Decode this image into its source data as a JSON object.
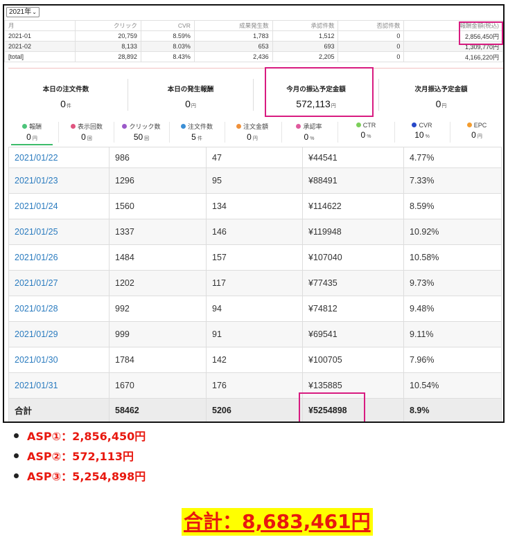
{
  "monthly": {
    "year_select": "2021年",
    "headers": [
      "月",
      "クリック",
      "CVR",
      "成果発生数",
      "承認件数",
      "否認件数",
      "報酬金額(税込)"
    ],
    "rows": [
      [
        "2021-01",
        "20,759",
        "8.59%",
        "1,783",
        "1,512",
        "0",
        "2,856,450円"
      ],
      [
        "2021-02",
        "8,133",
        "8.03%",
        "653",
        "693",
        "0",
        "1,309,770円"
      ],
      [
        "[total]",
        "28,892",
        "8.43%",
        "2,436",
        "2,205",
        "0",
        "4,166,220円"
      ]
    ]
  },
  "summary": [
    {
      "label": "本日の注文件数",
      "value": "0",
      "unit": "件"
    },
    {
      "label": "本日の発生報酬",
      "value": "0",
      "unit": "円"
    },
    {
      "label": "今月の振込予定金額",
      "value": "572,113",
      "unit": "円"
    },
    {
      "label": "次月振込予定金額",
      "value": "0",
      "unit": "円"
    }
  ],
  "metrics": [
    {
      "label": "報酬",
      "value": "0",
      "unit": "円",
      "color": "#4cc47a"
    },
    {
      "label": "表示回数",
      "value": "0",
      "unit": "回",
      "color": "#e0557f"
    },
    {
      "label": "クリック数",
      "value": "50",
      "unit": "回",
      "color": "#9b59c9"
    },
    {
      "label": "注文件数",
      "value": "5",
      "unit": "件",
      "color": "#3b8fd6"
    },
    {
      "label": "注文金額",
      "value": "0",
      "unit": "円",
      "color": "#f0913a"
    },
    {
      "label": "承認率",
      "value": "0",
      "unit": "%",
      "color": "#e05a9e"
    },
    {
      "label": "CTR",
      "value": "0",
      "unit": "%",
      "color": "#7ccf5a"
    },
    {
      "label": "CVR",
      "value": "10",
      "unit": "%",
      "color": "#2748c9"
    },
    {
      "label": "EPC",
      "value": "0",
      "unit": "円",
      "color": "#f39c2e"
    }
  ],
  "daily": {
    "rows": [
      [
        "2021/01/22",
        "986",
        "47",
        "¥44541",
        "4.77%"
      ],
      [
        "2021/01/23",
        "1296",
        "95",
        "¥88491",
        "7.33%"
      ],
      [
        "2021/01/24",
        "1560",
        "134",
        "¥114622",
        "8.59%"
      ],
      [
        "2021/01/25",
        "1337",
        "146",
        "¥119948",
        "10.92%"
      ],
      [
        "2021/01/26",
        "1484",
        "157",
        "¥107040",
        "10.58%"
      ],
      [
        "2021/01/27",
        "1202",
        "117",
        "¥77435",
        "9.73%"
      ],
      [
        "2021/01/28",
        "992",
        "94",
        "¥74812",
        "9.48%"
      ],
      [
        "2021/01/29",
        "999",
        "91",
        "¥69541",
        "9.11%"
      ],
      [
        "2021/01/30",
        "1784",
        "142",
        "¥100705",
        "7.96%"
      ],
      [
        "2021/01/31",
        "1670",
        "176",
        "¥135885",
        "10.54%"
      ]
    ],
    "total": [
      "合計",
      "58462",
      "5206",
      "¥5254898",
      "8.9%"
    ]
  },
  "bullets": [
    "ASP①：2,856,450円",
    "ASP②：572,113円",
    "ASP③：5,254,898円"
  ],
  "grand_total": "合計：8,683,461円",
  "highlight_color": "#d81b80",
  "accent_red": "#e8180f",
  "marker_yellow": "#ffff00"
}
